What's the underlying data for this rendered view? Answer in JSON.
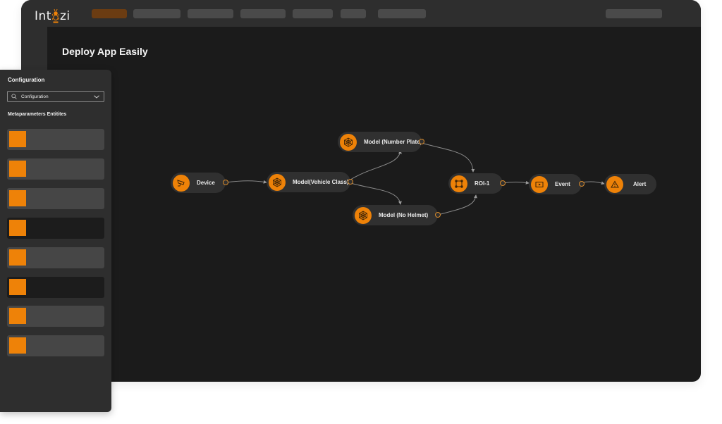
{
  "app": {
    "logo_text_left": "Int",
    "logo_text_right": "zi",
    "brand_color": "#ee8208"
  },
  "topbar": {
    "nav_items": [
      {
        "name": "nav-item-1",
        "active": true
      },
      {
        "name": "nav-item-2",
        "active": false
      },
      {
        "name": "nav-item-3",
        "active": false
      },
      {
        "name": "nav-item-4",
        "active": false
      },
      {
        "name": "nav-item-5",
        "active": false
      },
      {
        "name": "nav-item-6",
        "active": false
      },
      {
        "name": "nav-item-7",
        "active": false
      }
    ]
  },
  "page": {
    "title": "Deploy App Easily"
  },
  "pipeline": {
    "nodes": [
      {
        "id": "device",
        "label": "Device",
        "icon": "cctv-camera-icon"
      },
      {
        "id": "model_vehicle",
        "label": "Model(Vehicle Class)",
        "icon": "model-network-icon"
      },
      {
        "id": "model_plate",
        "label": "Model (Number Plate)",
        "icon": "model-network-icon"
      },
      {
        "id": "model_helmet",
        "label": "Model (No Helmet)",
        "icon": "model-network-icon"
      },
      {
        "id": "roi",
        "label": "ROI-1",
        "icon": "roi-square-icon"
      },
      {
        "id": "event",
        "label": "Event",
        "icon": "video-play-icon"
      },
      {
        "id": "alert",
        "label": "Alert",
        "icon": "warning-triangle-icon"
      }
    ],
    "edges": [
      [
        "device",
        "model_vehicle"
      ],
      [
        "model_vehicle",
        "model_plate"
      ],
      [
        "model_vehicle",
        "model_helmet"
      ],
      [
        "model_plate",
        "roi"
      ],
      [
        "model_helmet",
        "roi"
      ],
      [
        "roi",
        "event"
      ],
      [
        "event",
        "alert"
      ]
    ],
    "edge_color": "#8a8a8a",
    "port_color": "#d98a2a"
  },
  "config_panel": {
    "title": "Configuration",
    "select": {
      "value": "Configuration",
      "icon": "search-icon",
      "chevron": "chevron-down-icon"
    },
    "entities_title": "Metaparameters Entitites",
    "entities": [
      {
        "style": "light"
      },
      {
        "style": "light"
      },
      {
        "style": "light"
      },
      {
        "style": "dark"
      },
      {
        "style": "light"
      },
      {
        "style": "dark"
      },
      {
        "style": "light"
      },
      {
        "style": "light"
      }
    ]
  }
}
